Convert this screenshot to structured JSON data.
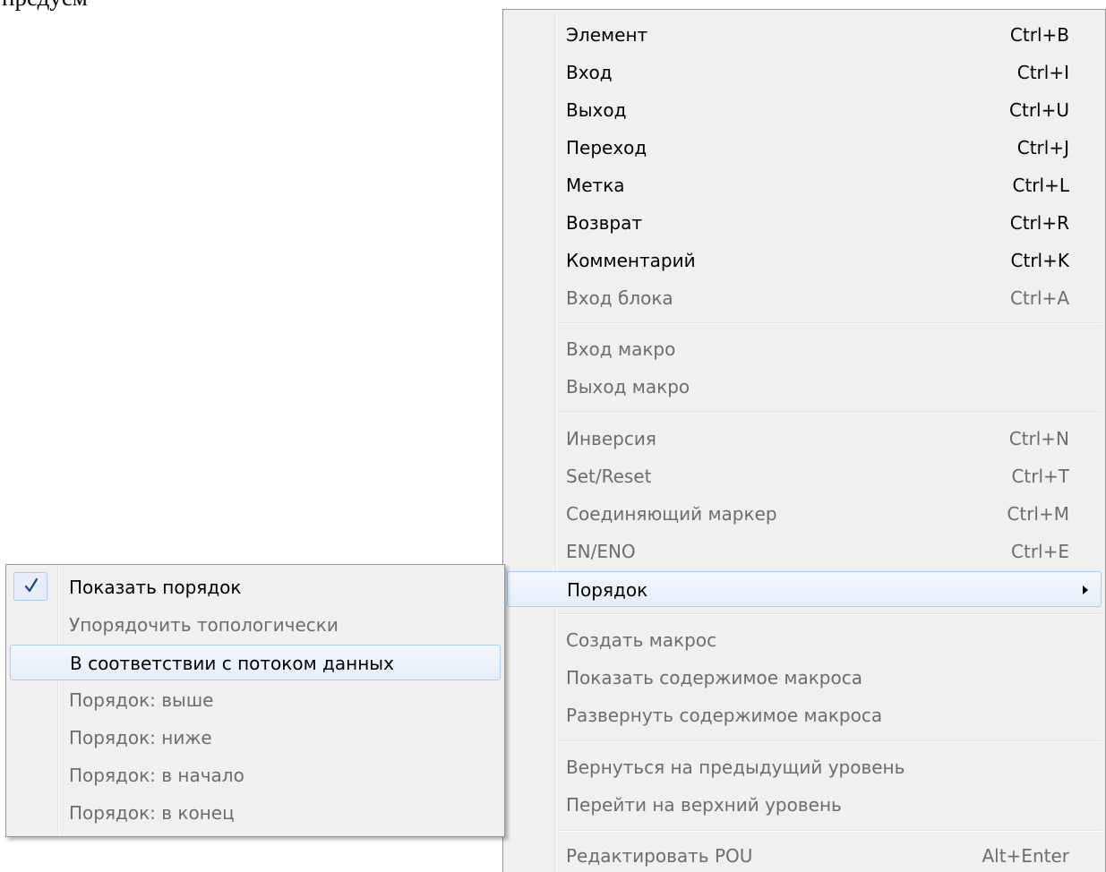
{
  "top_text": "предусм",
  "main_menu": {
    "items": [
      {
        "label": "Элемент",
        "shortcut": "Ctrl+B",
        "enabled": true
      },
      {
        "label": "Вход",
        "shortcut": "Ctrl+I",
        "enabled": true
      },
      {
        "label": "Выход",
        "shortcut": "Ctrl+U",
        "enabled": true
      },
      {
        "label": "Переход",
        "shortcut": "Ctrl+J",
        "enabled": true
      },
      {
        "label": "Метка",
        "shortcut": "Ctrl+L",
        "enabled": true
      },
      {
        "label": "Возврат",
        "shortcut": "Ctrl+R",
        "enabled": true
      },
      {
        "label": "Комментарий",
        "shortcut": "Ctrl+K",
        "enabled": true
      },
      {
        "label": "Вход блока",
        "shortcut": "Ctrl+A",
        "enabled": false
      },
      {
        "label": "Вход макро",
        "shortcut": "",
        "enabled": false
      },
      {
        "label": "Выход макро",
        "shortcut": "",
        "enabled": false
      },
      {
        "label": "Инверсия",
        "shortcut": "Ctrl+N",
        "enabled": false
      },
      {
        "label": "Set/Reset",
        "shortcut": "Ctrl+T",
        "enabled": false
      },
      {
        "label": "Соединяющий маркер",
        "shortcut": "Ctrl+M",
        "enabled": false
      },
      {
        "label": "EN/ENO",
        "shortcut": "Ctrl+E",
        "enabled": false
      },
      {
        "label": "Порядок",
        "shortcut": "",
        "enabled": true,
        "submenu": true
      },
      {
        "label": "Создать макрос",
        "shortcut": "",
        "enabled": false
      },
      {
        "label": "Показать содержимое макроса",
        "shortcut": "",
        "enabled": false
      },
      {
        "label": "Развернуть содержимое макроса",
        "shortcut": "",
        "enabled": false
      },
      {
        "label": "Вернуться на предыдущий уровень",
        "shortcut": "",
        "enabled": false
      },
      {
        "label": "Перейти на верхний уровень",
        "shortcut": "",
        "enabled": false
      },
      {
        "label": "Редактировать POU",
        "shortcut": "Alt+Enter",
        "enabled": false
      }
    ]
  },
  "sub_menu": {
    "items": [
      {
        "label": "Показать порядок",
        "enabled": true,
        "checked": true
      },
      {
        "label": "Упорядочить топологически",
        "enabled": false
      },
      {
        "label": "В соответствии с потоком данных",
        "enabled": true
      },
      {
        "label": "Порядок: выше",
        "enabled": false
      },
      {
        "label": "Порядок: ниже",
        "enabled": false
      },
      {
        "label": "Порядок: в начало",
        "enabled": false
      },
      {
        "label": "Порядок: в конец",
        "enabled": false
      }
    ]
  },
  "colors": {
    "menu_bg": "#f0f0f0",
    "disabled_text": "#6d6d6d",
    "highlight_border": "#aeccf2",
    "check_color": "#1c3f94"
  },
  "icons": {
    "check": "check-icon",
    "submenu_arrow": "chevron-right-icon"
  }
}
